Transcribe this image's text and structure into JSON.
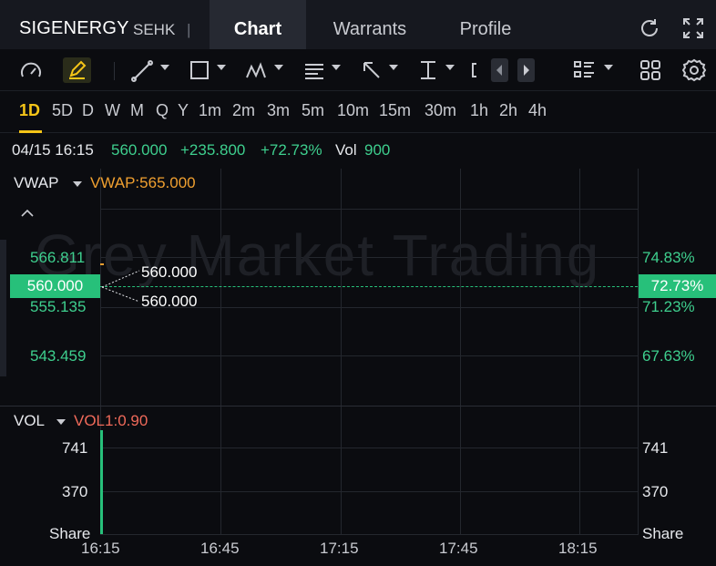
{
  "header": {
    "symbol": "SIGENERGY",
    "exchange": "SEHK",
    "separator": "|",
    "tabs": [
      {
        "label": "Chart",
        "active": true
      },
      {
        "label": "Warrants",
        "active": false
      },
      {
        "label": "Profile",
        "active": false
      }
    ],
    "icons": [
      "refresh-icon",
      "fullscreen-icon"
    ]
  },
  "toolbar": {
    "tools": [
      "gauge-icon",
      "draw-pen-icon",
      "trendline-icon",
      "rectangle-icon",
      "pattern-icon",
      "text-note-icon",
      "arrow-icon",
      "measure-icon",
      "bracket-icon"
    ],
    "nav": [
      "prev-arrow-icon",
      "next-arrow-icon"
    ],
    "right": [
      "layout-list-icon",
      "grid-icon",
      "gear-icon"
    ]
  },
  "timeframes": {
    "items": [
      "1D",
      "5D",
      "D",
      "W",
      "M",
      "Q",
      "Y",
      "1m",
      "2m",
      "3m",
      "5m",
      "10m",
      "15m",
      "30m",
      "1h",
      "2h",
      "4h"
    ],
    "selected": "1D"
  },
  "quote": {
    "datetime": "04/15 16:15",
    "price": "560.000",
    "change": "+235.800",
    "change_pct": "+72.73%",
    "vol_label": "Vol",
    "vol_value": "900"
  },
  "main_panel": {
    "indicator": "VWAP",
    "indicator_value": "VWAP:565.000",
    "watermark": "Grey Market Trading",
    "collapse_icon": "chevron-up-icon",
    "y_left": [
      "566.811",
      "560.000",
      "555.135",
      "543.459"
    ],
    "y_right": [
      "74.83%",
      "72.73%",
      "71.23%",
      "67.63%"
    ],
    "current_price_tag": "560.000",
    "current_pct_tag": "72.73%",
    "annotation_high": "560.000",
    "annotation_low": "560.000"
  },
  "volume_panel": {
    "indicator": "VOL",
    "indicator_value": "VOL1:0.90",
    "y_left": [
      "741",
      "370",
      "Share"
    ],
    "y_right": [
      "741",
      "370",
      "Share"
    ]
  },
  "x_axis": [
    "16:15",
    "16:45",
    "17:15",
    "17:45",
    "18:15"
  ],
  "colors": {
    "up": "#27c07a",
    "accent": "#f5c518",
    "vwap": "#f0a030",
    "vol_indicator": "#f06a5a"
  }
}
